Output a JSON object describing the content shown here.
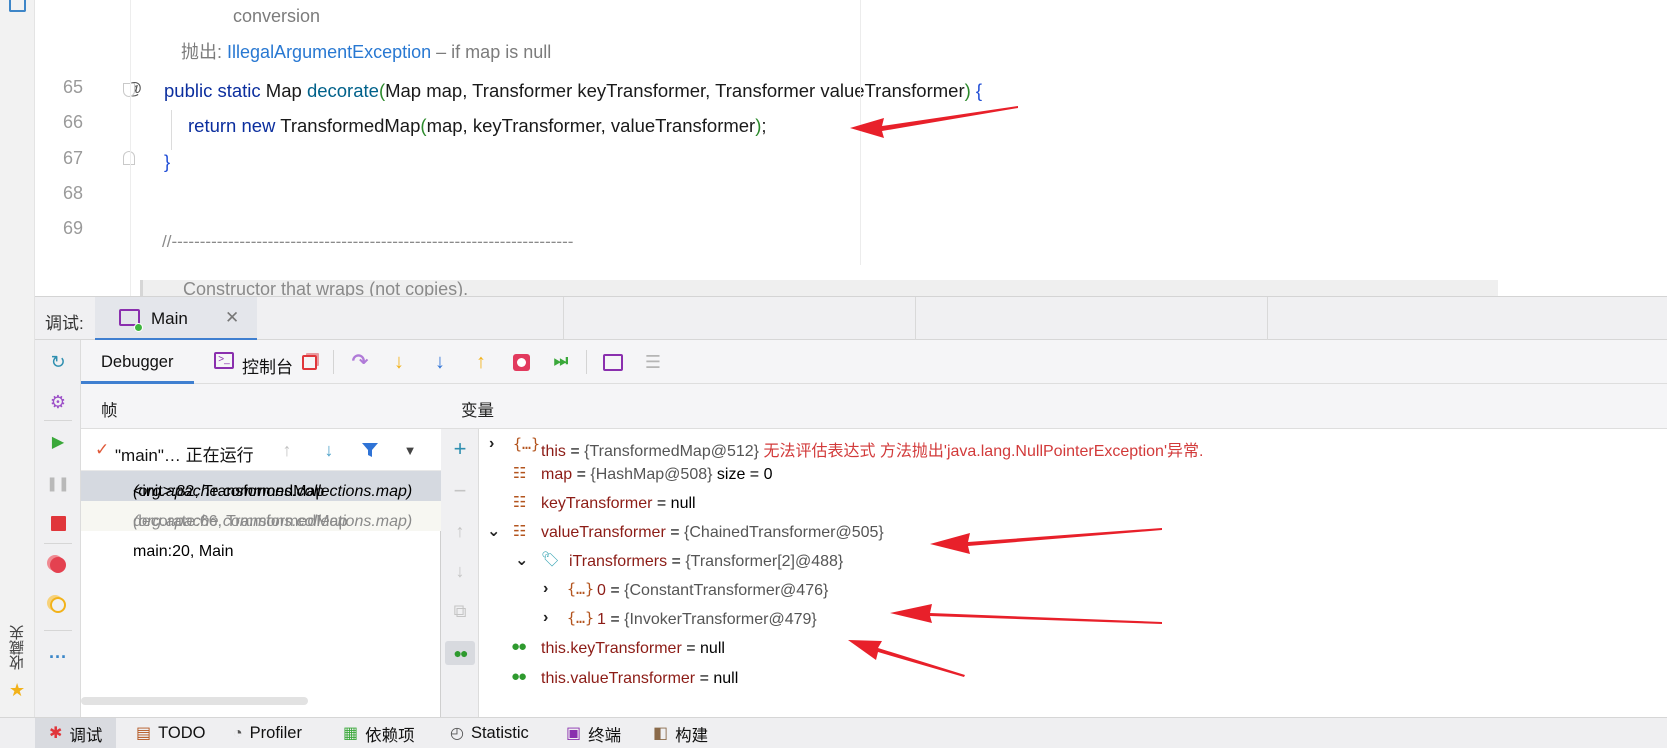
{
  "editor": {
    "doc_conversion": "conversion",
    "doc_throws_label": "抛出:",
    "doc_throws_exception": "IllegalArgumentException",
    "doc_throws_desc": "– if map is null",
    "line_numbers": [
      "65",
      "66",
      "67",
      "68",
      "69"
    ],
    "at_mark": "@",
    "code": {
      "line65_kw": "public static ",
      "line65_type": "Map ",
      "line65_fn": "decorate",
      "line65_open": "(",
      "line65_params": "Map map, Transformer keyTransformer, Transformer valueTransformer",
      "line65_close": ")",
      "line65_brace": " {",
      "line66_kw": "return new ",
      "line66_rest": "TransformedMap",
      "line66_open": "(",
      "line66_args": "map, keyTransformer, valueTransformer",
      "line66_close": ")",
      "line66_end": ";",
      "line67": "}",
      "line69": "//-----------------------------------------------------------------------"
    },
    "doc_constructor": "Constructor that wraps (not copies)."
  },
  "debug_tabs": {
    "title": "调试:",
    "main_tab": "Main",
    "close_glyph": "✕"
  },
  "sub_toolbar": {
    "debugger_tab": "Debugger",
    "console_tab": "控制台"
  },
  "frames": {
    "header": "帧",
    "thread_label": "\"main\"… 正在运行",
    "rows": [
      {
        "method": "<init>:82, TransformedMap ",
        "pkg": "(org.apache.commons.collections.map)"
      },
      {
        "method": "decorate:66, TransformedMap ",
        "pkg": "(org.apache.commons.collections.map)"
      },
      {
        "method": "main:20, Main",
        "pkg": ""
      }
    ]
  },
  "variables": {
    "header": "变量",
    "rows": [
      {
        "name": "this",
        "eq": " = ",
        "val": "{TransformedMap@512} ",
        "err": "无法评估表达式 方法抛出'java.lang.NullPointerException'异常."
      },
      {
        "name": "map",
        "eq": " = ",
        "val": "{HashMap@508} ",
        "extra": " size = 0"
      },
      {
        "name": "keyTransformer",
        "eq": " = ",
        "val": "null"
      },
      {
        "name": "valueTransformer",
        "eq": " = ",
        "val": "{ChainedTransformer@505}"
      },
      {
        "name": "iTransformers",
        "eq": " = ",
        "val": "{Transformer[2]@488}"
      },
      {
        "name": "0",
        "eq": " = ",
        "val": "{ConstantTransformer@476}"
      },
      {
        "name": "1",
        "eq": " = ",
        "val": "{InvokerTransformer@479}"
      },
      {
        "name": "this.keyTransformer",
        "eq": " = ",
        "val": "null"
      },
      {
        "name": "this.valueTransformer",
        "eq": " = ",
        "val": "null"
      }
    ]
  },
  "favorites": {
    "label": "收藏夹"
  },
  "bottom_bar": {
    "items": [
      "调试",
      "TODO",
      "Profiler",
      "依赖项",
      "Statistic",
      "终端",
      "构建"
    ]
  },
  "colors": {
    "accent": "#3f7fd0",
    "keyword": "#0b2e9e",
    "var_name": "#8c1c16",
    "error": "#d23a3a",
    "arrow": "#e8202a"
  }
}
